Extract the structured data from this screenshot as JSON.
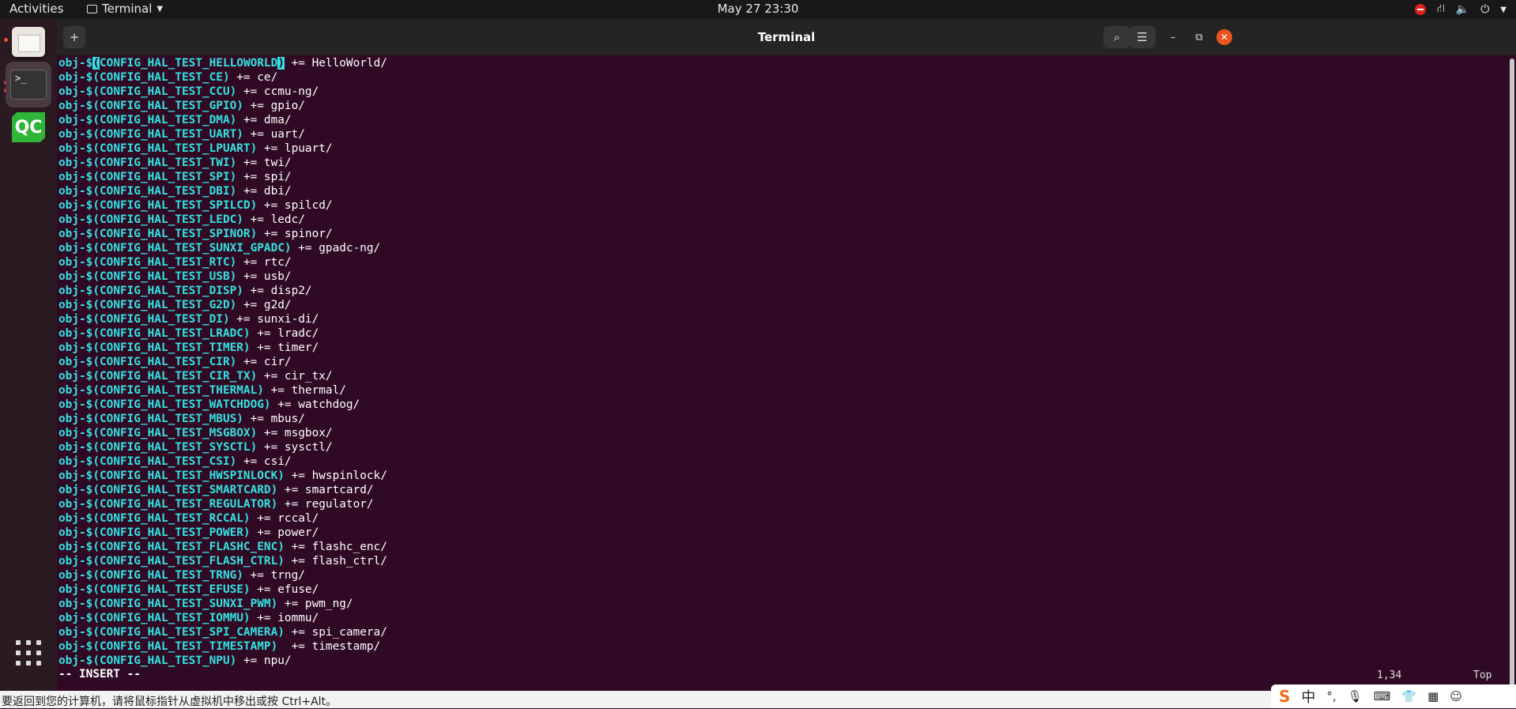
{
  "topbar": {
    "activities": "Activities",
    "app_name": "Terminal",
    "clock": "May 27  23:30",
    "tray_icons": [
      "update-alert-icon",
      "network-icon",
      "volume-icon",
      "power-icon",
      "chevron-down-icon"
    ]
  },
  "dock": {
    "items": [
      "files-icon",
      "terminal-icon",
      "qtcreator-icon"
    ],
    "qc_label": "QC",
    "terminal_prompt": ">_"
  },
  "window": {
    "title": "Terminal",
    "new_tab_icon": "+",
    "search_icon": "⌕",
    "menu_icon": "☰",
    "minimize": "–",
    "maximize": "⧉",
    "close": "✕"
  },
  "terminal": {
    "lines": [
      {
        "prefix": "obj-$",
        "var": "(CONFIG_HAL_TEST_HELLOWORLD)",
        "rest": " += HelloWorld/"
      },
      {
        "prefix": "obj-$",
        "var": "(CONFIG_HAL_TEST_CE)",
        "rest": " += ce/"
      },
      {
        "prefix": "obj-$",
        "var": "(CONFIG_HAL_TEST_CCU)",
        "rest": " += ccmu-ng/"
      },
      {
        "prefix": "obj-$",
        "var": "(CONFIG_HAL_TEST_GPIO)",
        "rest": " += gpio/"
      },
      {
        "prefix": "obj-$",
        "var": "(CONFIG_HAL_TEST_DMA)",
        "rest": " += dma/"
      },
      {
        "prefix": "obj-$",
        "var": "(CONFIG_HAL_TEST_UART)",
        "rest": " += uart/"
      },
      {
        "prefix": "obj-$",
        "var": "(CONFIG_HAL_TEST_LPUART)",
        "rest": " += lpuart/"
      },
      {
        "prefix": "obj-$",
        "var": "(CONFIG_HAL_TEST_TWI)",
        "rest": " += twi/"
      },
      {
        "prefix": "obj-$",
        "var": "(CONFIG_HAL_TEST_SPI)",
        "rest": " += spi/"
      },
      {
        "prefix": "obj-$",
        "var": "(CONFIG_HAL_TEST_DBI)",
        "rest": " += dbi/"
      },
      {
        "prefix": "obj-$",
        "var": "(CONFIG_HAL_TEST_SPILCD)",
        "rest": " += spilcd/"
      },
      {
        "prefix": "obj-$",
        "var": "(CONFIG_HAL_TEST_LEDC)",
        "rest": " += ledc/"
      },
      {
        "prefix": "obj-$",
        "var": "(CONFIG_HAL_TEST_SPINOR)",
        "rest": " += spinor/"
      },
      {
        "prefix": "obj-$",
        "var": "(CONFIG_HAL_TEST_SUNXI_GPADC)",
        "rest": " += gpadc-ng/"
      },
      {
        "prefix": "obj-$",
        "var": "(CONFIG_HAL_TEST_RTC)",
        "rest": " += rtc/"
      },
      {
        "prefix": "obj-$",
        "var": "(CONFIG_HAL_TEST_USB)",
        "rest": " += usb/"
      },
      {
        "prefix": "obj-$",
        "var": "(CONFIG_HAL_TEST_DISP)",
        "rest": " += disp2/"
      },
      {
        "prefix": "obj-$",
        "var": "(CONFIG_HAL_TEST_G2D)",
        "rest": " += g2d/"
      },
      {
        "prefix": "obj-$",
        "var": "(CONFIG_HAL_TEST_DI)",
        "rest": " += sunxi-di/"
      },
      {
        "prefix": "obj-$",
        "var": "(CONFIG_HAL_TEST_LRADC)",
        "rest": " += lradc/"
      },
      {
        "prefix": "obj-$",
        "var": "(CONFIG_HAL_TEST_TIMER)",
        "rest": " += timer/"
      },
      {
        "prefix": "obj-$",
        "var": "(CONFIG_HAL_TEST_CIR)",
        "rest": " += cir/"
      },
      {
        "prefix": "obj-$",
        "var": "(CONFIG_HAL_TEST_CIR_TX)",
        "rest": " += cir_tx/"
      },
      {
        "prefix": "obj-$",
        "var": "(CONFIG_HAL_TEST_THERMAL)",
        "rest": " += thermal/"
      },
      {
        "prefix": "obj-$",
        "var": "(CONFIG_HAL_TEST_WATCHDOG)",
        "rest": " += watchdog/"
      },
      {
        "prefix": "obj-$",
        "var": "(CONFIG_HAL_TEST_MBUS)",
        "rest": " += mbus/"
      },
      {
        "prefix": "obj-$",
        "var": "(CONFIG_HAL_TEST_MSGBOX)",
        "rest": " += msgbox/"
      },
      {
        "prefix": "obj-$",
        "var": "(CONFIG_HAL_TEST_SYSCTL)",
        "rest": " += sysctl/"
      },
      {
        "prefix": "obj-$",
        "var": "(CONFIG_HAL_TEST_CSI)",
        "rest": " += csi/"
      },
      {
        "prefix": "obj-$",
        "var": "(CONFIG_HAL_TEST_HWSPINLOCK)",
        "rest": " += hwspinlock/"
      },
      {
        "prefix": "obj-$",
        "var": "(CONFIG_HAL_TEST_SMARTCARD)",
        "rest": " += smartcard/"
      },
      {
        "prefix": "obj-$",
        "var": "(CONFIG_HAL_TEST_REGULATOR)",
        "rest": " += regulator/"
      },
      {
        "prefix": "obj-$",
        "var": "(CONFIG_HAL_TEST_RCCAL)",
        "rest": " += rccal/"
      },
      {
        "prefix": "obj-$",
        "var": "(CONFIG_HAL_TEST_POWER)",
        "rest": " += power/"
      },
      {
        "prefix": "obj-$",
        "var": "(CONFIG_HAL_TEST_FLASHC_ENC)",
        "rest": " += flashc_enc/"
      },
      {
        "prefix": "obj-$",
        "var": "(CONFIG_HAL_TEST_FLASH_CTRL)",
        "rest": " += flash_ctrl/"
      },
      {
        "prefix": "obj-$",
        "var": "(CONFIG_HAL_TEST_TRNG)",
        "rest": " += trng/"
      },
      {
        "prefix": "obj-$",
        "var": "(CONFIG_HAL_TEST_EFUSE)",
        "rest": " += efuse/"
      },
      {
        "prefix": "obj-$",
        "var": "(CONFIG_HAL_TEST_SUNXI_PWM)",
        "rest": " += pwm_ng/"
      },
      {
        "prefix": "obj-$",
        "var": "(CONFIG_HAL_TEST_IOMMU)",
        "rest": " += iommu/"
      },
      {
        "prefix": "obj-$",
        "var": "(CONFIG_HAL_TEST_SPI_CAMERA)",
        "rest": " += spi_camera/"
      },
      {
        "prefix": "obj-$",
        "var": "(CONFIG_HAL_TEST_TIMESTAMP)",
        "rest": "  += timestamp/"
      },
      {
        "prefix": "obj-$",
        "var": "(CONFIG_HAL_TEST_NPU)",
        "rest": " += npu/"
      }
    ],
    "mode": "-- INSERT --",
    "cursor_pos": "1,34",
    "scroll_pos": "Top"
  },
  "host": {
    "message": "要返回到您的计算机，请将鼠标指针从虚拟机中移出或按 Ctrl+Alt。",
    "ime_logo": "S",
    "ime_lang": "中",
    "ime_punct": "°,",
    "ime_icons": [
      "microphone-icon",
      "keyboard-icon",
      "skin-icon",
      "grid-icon",
      "avatar-icon"
    ]
  },
  "colors": {
    "terminal_bg": "#300a24",
    "keyword": "#34e2e2",
    "accent": "#e95420"
  }
}
